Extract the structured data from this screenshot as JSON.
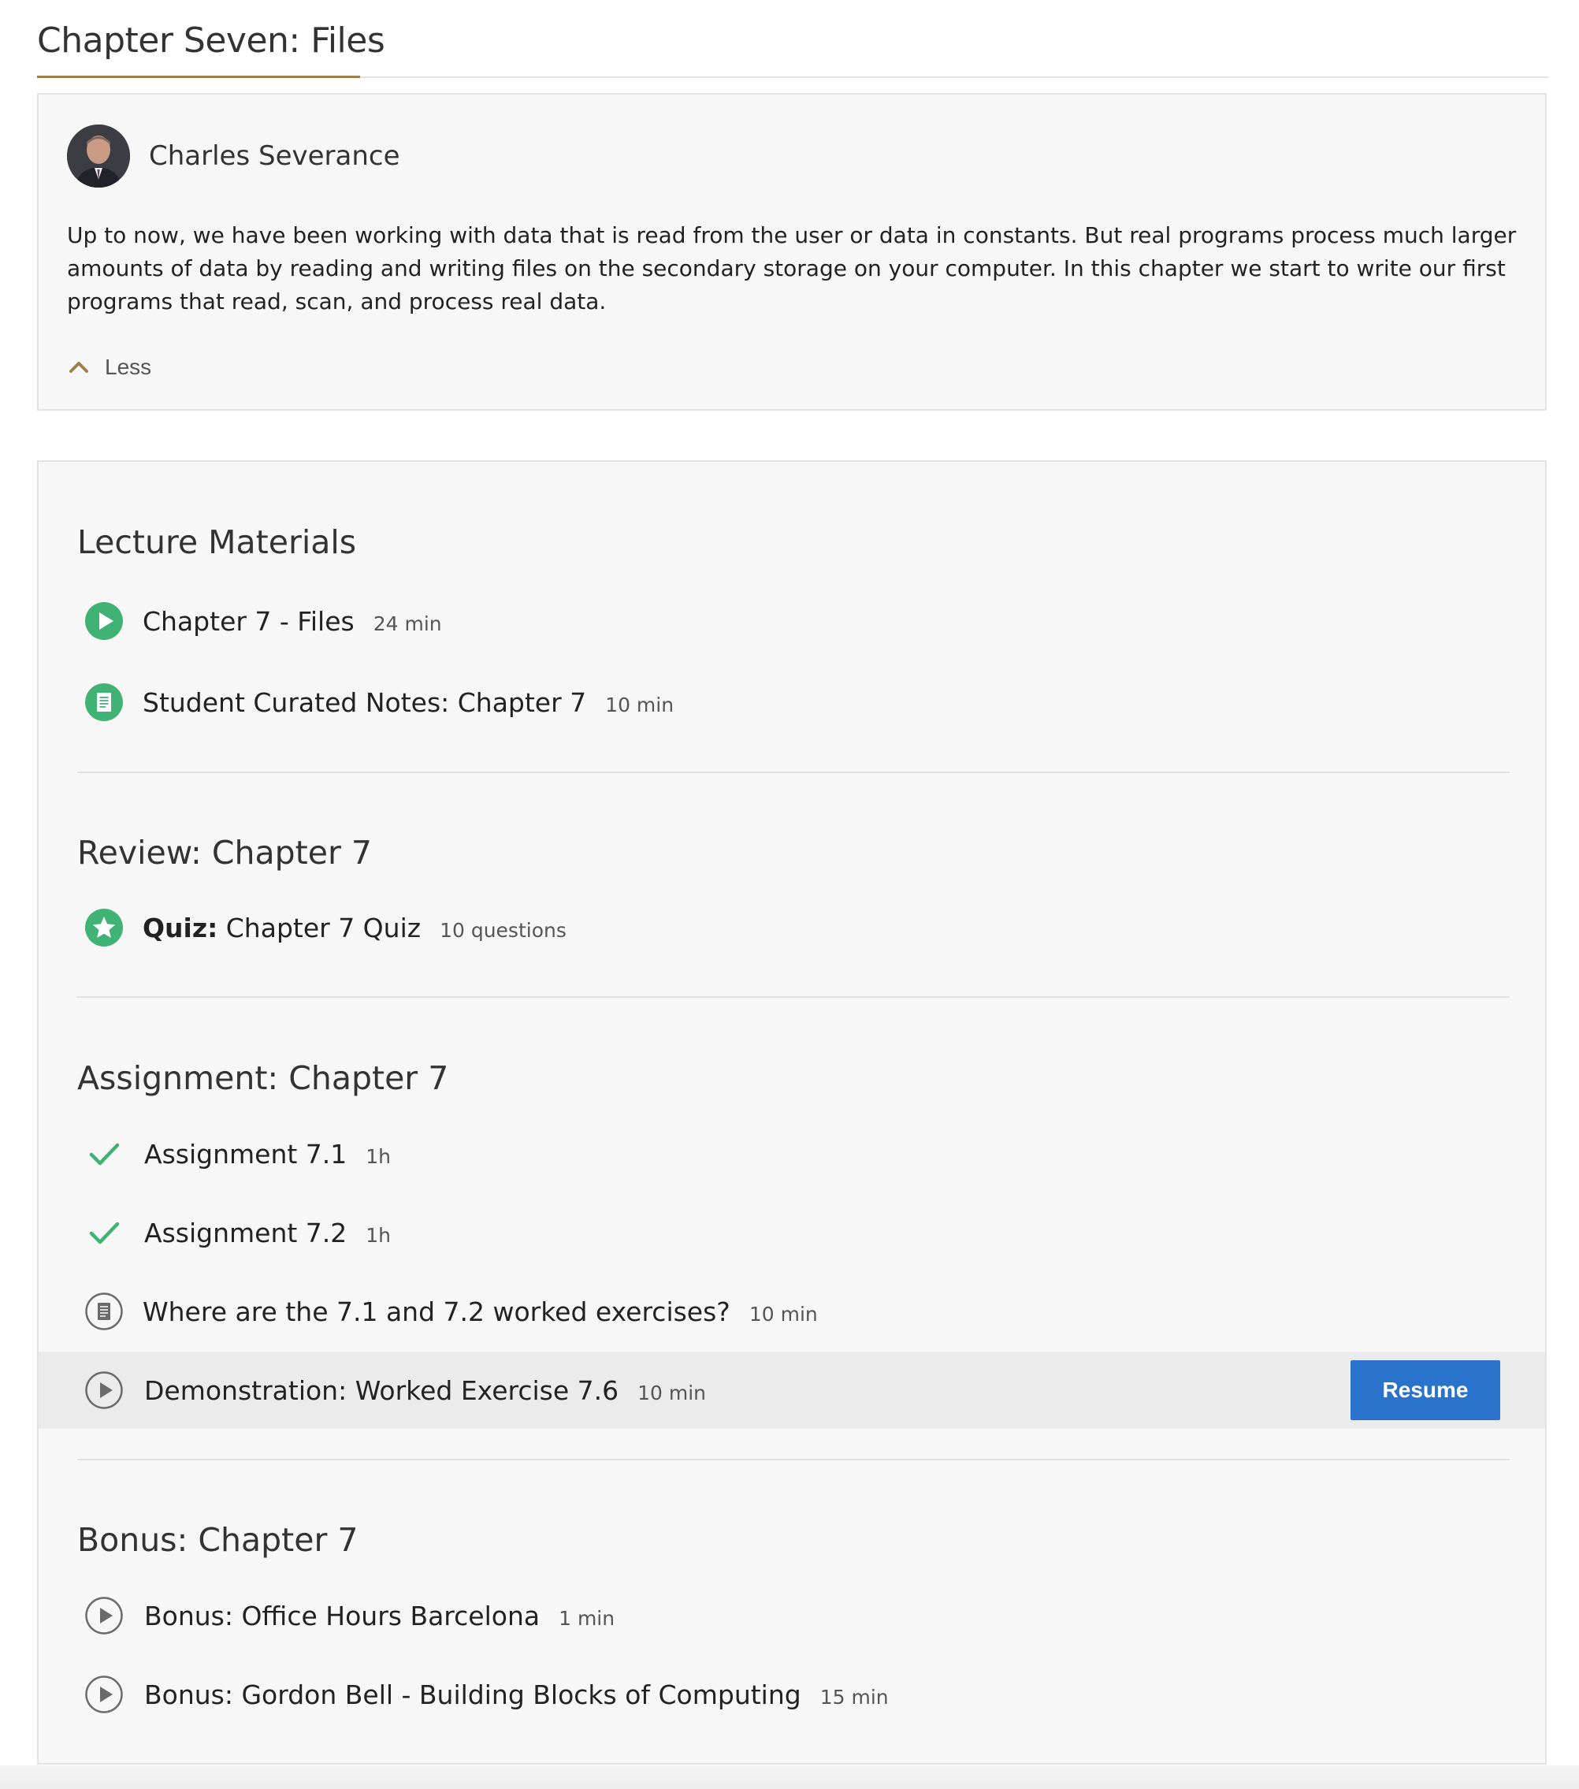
{
  "header": {
    "title": "Chapter Seven: Files"
  },
  "intro": {
    "instructor": "Charles Severance",
    "description": "Up to now, we have been working with data that is read from the user or data in constants. But real programs process much larger amounts of data by reading and writing files on the secondary storage on your computer. In this chapter we start to write our first programs that read, scan, and process real data.",
    "toggle_label": "Less"
  },
  "colors": {
    "accent_gold": "#9f7e4e",
    "complete_green": "#3fb274",
    "button_blue": "#2a73cc",
    "neutral_icon": "#6b6b6b"
  },
  "sections": [
    {
      "title": "Lecture Materials",
      "items": [
        {
          "icon": "play-circle-filled-icon",
          "label": "Chapter 7 - Files",
          "meta": "24 min",
          "status": "completed"
        },
        {
          "icon": "reading-circle-filled-icon",
          "label": "Student Curated Notes: Chapter 7",
          "meta": "10 min",
          "status": "completed"
        }
      ]
    },
    {
      "title": "Review: Chapter 7",
      "items": [
        {
          "icon": "star-circle-filled-icon",
          "prefix": "Quiz:",
          "label": "Chapter 7 Quiz",
          "meta": "10 questions",
          "status": "completed"
        }
      ]
    },
    {
      "title": "Assignment: Chapter 7",
      "items": [
        {
          "icon": "checkmark-icon",
          "label": "Assignment 7.1",
          "meta": "1h",
          "status": "completed"
        },
        {
          "icon": "checkmark-icon",
          "label": "Assignment 7.2",
          "meta": "1h",
          "status": "completed"
        },
        {
          "icon": "reading-circle-outline-icon",
          "label": "Where are the 7.1 and 7.2 worked exercises?",
          "meta": "10 min",
          "status": "not-started"
        },
        {
          "icon": "play-circle-outline-icon",
          "label": "Demonstration: Worked Exercise 7.6",
          "meta": "10 min",
          "status": "in-progress",
          "action_label": "Resume"
        }
      ]
    },
    {
      "title": "Bonus: Chapter 7",
      "items": [
        {
          "icon": "play-circle-outline-icon",
          "label": "Bonus: Office Hours Barcelona",
          "meta": "1 min",
          "status": "not-started"
        },
        {
          "icon": "play-circle-outline-icon",
          "label": "Bonus: Gordon Bell - Building Blocks of Computing",
          "meta": "15 min",
          "status": "not-started"
        }
      ]
    }
  ]
}
